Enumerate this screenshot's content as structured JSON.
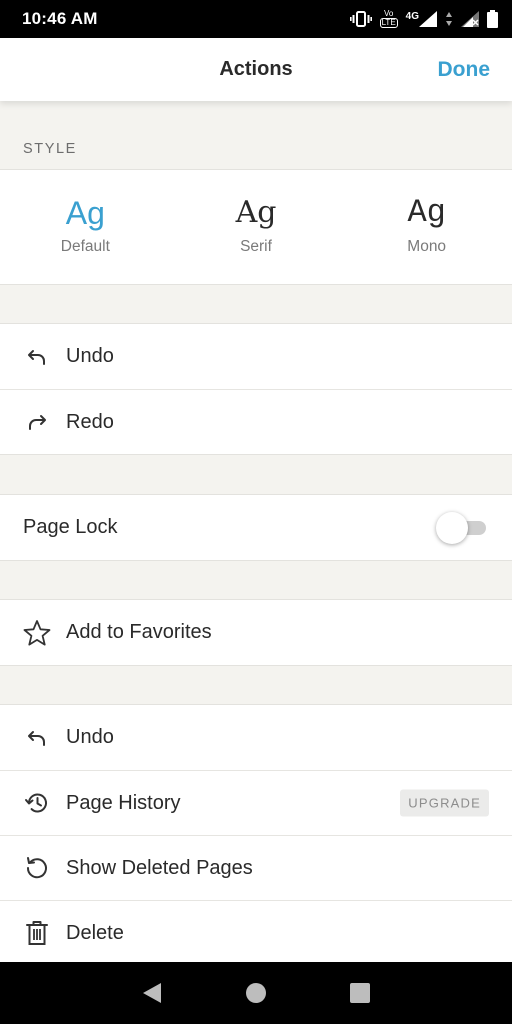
{
  "status_bar": {
    "time": "10:46 AM",
    "icons": [
      "vibrate-icon",
      "volte-icon",
      "signal-4g-icon",
      "signal-icon",
      "battery-icon"
    ],
    "lte_top": "Vo",
    "lte_bottom": "LTE",
    "network": "4G"
  },
  "header": {
    "title": "Actions",
    "done_label": "Done"
  },
  "style_section": {
    "label": "STYLE",
    "options": [
      {
        "sample": "Ag",
        "name": "Default",
        "selected": true
      },
      {
        "sample": "Ag",
        "name": "Serif",
        "selected": false
      },
      {
        "sample": "Ag",
        "name": "Mono",
        "selected": false
      }
    ]
  },
  "edit_group": {
    "items": [
      {
        "label": "Undo",
        "icon": "undo-icon"
      },
      {
        "label": "Redo",
        "icon": "redo-icon"
      }
    ]
  },
  "lock_group": {
    "label": "Page Lock",
    "toggle_on": false
  },
  "favorites_group": {
    "label": "Add to Favorites",
    "icon": "star-icon"
  },
  "page_group": {
    "items": [
      {
        "label": "Undo",
        "icon": "undo-icon"
      },
      {
        "label": "Page History",
        "icon": "history-icon",
        "badge": "UPGRADE"
      },
      {
        "label": "Show Deleted Pages",
        "icon": "restore-icon"
      },
      {
        "label": "Delete",
        "icon": "trash-icon"
      }
    ]
  },
  "nav_bar": {
    "buttons": [
      "back-icon",
      "home-icon",
      "recents-icon"
    ]
  },
  "colors": {
    "accent": "#3aa0d0",
    "background": "#f4f3ef",
    "text": "#2a2a2a"
  }
}
